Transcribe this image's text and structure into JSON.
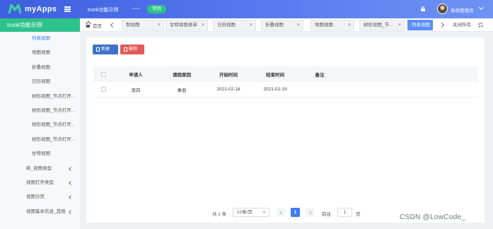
{
  "header": {
    "app_name": "myApps",
    "page_title": "trunk功能示例",
    "more_label": "···",
    "badge_label": "常用",
    "user_name": "系统管理员"
  },
  "sidebar": {
    "title": "trunk功能示例",
    "sub_items": [
      "列表视图",
      "地图视图",
      "折叠视图",
      "日历视图",
      "树形视图_节点打开...",
      "树形视图_节点打开...",
      "树形视图_节点打开...",
      "树形视图_节点打开...",
      "甘特视图"
    ],
    "active_index": 0,
    "groups": [
      "新_视图类型",
      "视图打开类型",
      "视图分页",
      "视图基本信息_其他"
    ]
  },
  "tabs": {
    "home_label": "首页",
    "items": [
      {
        "label": "制视图",
        "close": "×"
      },
      {
        "label": "甘特视图表单",
        "close": "×"
      },
      {
        "label": "日历视图",
        "close": "×"
      },
      {
        "label": "折叠视图",
        "close": "×"
      },
      {
        "label": "地图视图",
        "close": "×"
      },
      {
        "label": "树形视图_节...",
        "close": "×"
      },
      {
        "label": "列表视图",
        "close": ""
      }
    ],
    "close_all_label": "关闭所有"
  },
  "toolbar": {
    "new_label": "新建",
    "delete_label": "删除"
  },
  "table": {
    "columns": [
      "申请人",
      "请假原因",
      "开始时间",
      "结束时间",
      "备注"
    ],
    "rows": [
      [
        "李四",
        "事假",
        "2021-02-18",
        "2021-02-19",
        ""
      ]
    ]
  },
  "pagination": {
    "total_text": "共 1 条",
    "page_size": "10条/页",
    "current_page": "1",
    "goto_label": "前往",
    "goto_value": "1",
    "goto_unit": "页"
  },
  "watermark": "CSDN @LowCode_",
  "colors": {
    "topbar": "#3d5fe0",
    "sidebar_head": "#2ec28c",
    "active_tab": "#5b8ef7",
    "new_button": "#3e72c8",
    "delete_button": "#e05a5a",
    "active_page": "#3d7cf5"
  }
}
